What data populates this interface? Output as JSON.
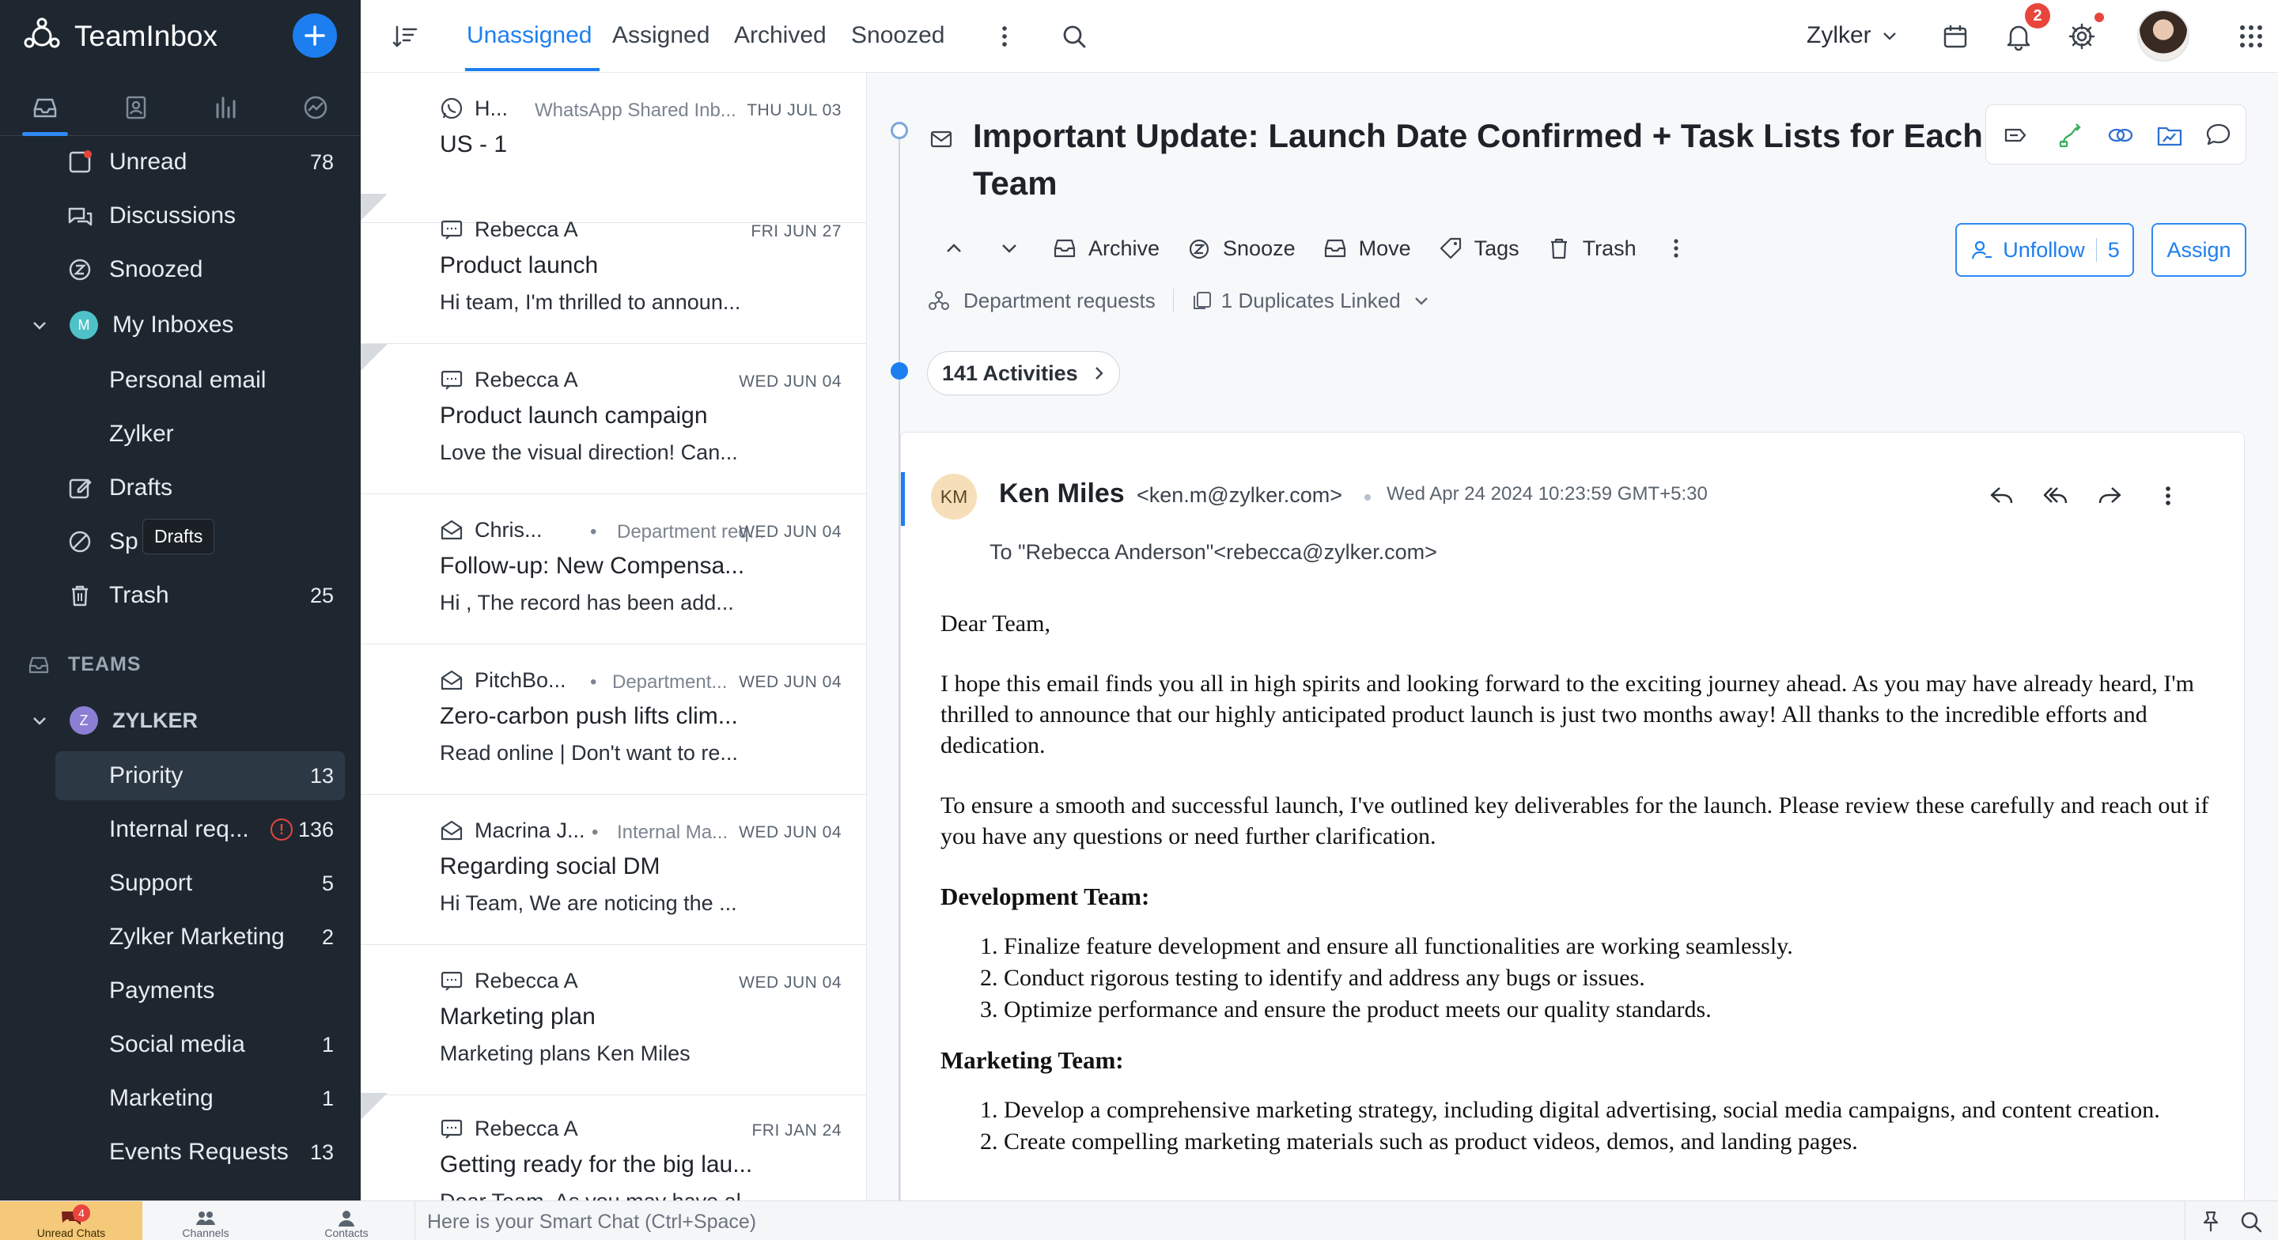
{
  "app": {
    "name": "TeamInbox"
  },
  "sidebar": {
    "tabs": [
      "inbox-tab",
      "contacts-tab",
      "reports-tab",
      "analytics-tab"
    ],
    "items": [
      {
        "label": "Unread",
        "count": "78",
        "icon": "unread-icon"
      },
      {
        "label": "Discussions",
        "count": "",
        "icon": "discussions-icon"
      },
      {
        "label": "Snoozed",
        "count": "",
        "icon": "snooze-icon"
      }
    ],
    "my_inboxes": {
      "label": "My Inboxes",
      "avatar": "M",
      "items": [
        "Personal email",
        "Zylker"
      ]
    },
    "drafts": {
      "label": "Drafts"
    },
    "spam": {
      "label": "Sp"
    },
    "trash": {
      "label": "Trash",
      "count": "25"
    },
    "tooltip": "Drafts",
    "teams": {
      "header": "TEAMS",
      "team_name": "ZYLKER",
      "avatar": "Z"
    },
    "team_items": [
      {
        "label": "Priority",
        "count": "13"
      },
      {
        "label": "Internal req...",
        "count": "136",
        "alert": "!"
      },
      {
        "label": "Support",
        "count": "5"
      },
      {
        "label": "Zylker Marketing",
        "count": "2"
      },
      {
        "label": "Payments",
        "count": ""
      },
      {
        "label": "Social media",
        "count": "1"
      },
      {
        "label": "Marketing",
        "count": "1"
      },
      {
        "label": "Events Requests",
        "count": "13"
      }
    ]
  },
  "topbar": {
    "tabs": [
      "Unassigned",
      "Assigned",
      "Archived",
      "Snoozed"
    ],
    "org": "Zylker",
    "notif_count": "2"
  },
  "tickets": [
    {
      "from": "H...",
      "inbox": "WhatsApp Shared Inb...",
      "date": "THU JUL 03",
      "subject": "US - 1",
      "preview": "",
      "icon": "whatsapp-icon"
    },
    {
      "from": "Rebecca A",
      "inbox": "",
      "date": "FRI JUN 27",
      "subject": "Product launch",
      "preview": "Hi team, I'm thrilled to announ...",
      "icon": "chat-icon"
    },
    {
      "from": "Rebecca A",
      "inbox": "",
      "date": "WED JUN 04",
      "subject": "Product launch campaign",
      "preview": "Love the visual direction! Can...",
      "icon": "chat-icon"
    },
    {
      "from": "Chris...",
      "inbox": "Department req...",
      "date": "WED JUN 04",
      "subject": "Follow-up: New Compensa...",
      "preview": "Hi , The record has been add...",
      "icon": "mail-icon"
    },
    {
      "from": "PitchBo...",
      "inbox": "Department...",
      "date": "WED JUN 04",
      "subject": "Zero-carbon push lifts clim...",
      "preview": "Read online | Don't want to re...",
      "icon": "mail-icon"
    },
    {
      "from": "Macrina J...",
      "inbox": "Internal Ma...",
      "date": "WED JUN 04",
      "subject": "Regarding social DM",
      "preview": "Hi Team, We are noticing the ...",
      "icon": "mail-icon"
    },
    {
      "from": "Rebecca A",
      "inbox": "",
      "date": "WED JUN 04",
      "subject": "Marketing plan",
      "preview": "Marketing plans Ken Miles",
      "icon": "chat-icon"
    },
    {
      "from": "Rebecca A",
      "inbox": "",
      "date": "FRI JAN 24",
      "subject": "Getting ready for the big lau...",
      "preview": "Dear Team, As you may have al...",
      "icon": "chat-icon"
    }
  ],
  "detail": {
    "subject": "Important Update: Launch Date Confirmed + Task Lists for Each Team",
    "toolbar": {
      "archive": "Archive",
      "snooze": "Snooze",
      "move": "Move",
      "tags": "Tags",
      "trash": "Trash"
    },
    "unfollow": "Unfollow",
    "followers": "5",
    "assign": "Assign",
    "department": "Department requests",
    "duplicates": "1 Duplicates Linked",
    "activities": "141 Activities",
    "message": {
      "initials": "KM",
      "sender": "Ken Miles",
      "email": "<ken.m@zylker.com>",
      "date": "Wed Apr 24 2024 10:23:59 GMT+5:30",
      "to": "To  \"Rebecca Anderson\"<rebecca@zylker.com>",
      "greeting": "Dear Team,",
      "para1": "I hope this email finds you all in high spirits and looking forward to the exciting journey ahead. As you may have already heard, I'm thrilled to announce that our highly anticipated product launch is just two months away! All thanks to the incredible efforts and dedication.",
      "para2": "To ensure a smooth and successful launch, I've outlined key deliverables for the launch. Please review these carefully and reach out if you have any questions or need further clarification.",
      "dev_heading": "Development Team:",
      "dev_items": [
        "Finalize feature development and ensure all functionalities are working seamlessly.",
        "Conduct rigorous testing to identify and address any bugs or issues.",
        "Optimize performance and ensure the product meets our quality standards."
      ],
      "mkt_heading": "Marketing Team:",
      "mkt_items": [
        "Develop a comprehensive marketing strategy, including digital advertising, social media campaigns, and content creation.",
        "Create compelling marketing materials such as product videos, demos, and landing pages."
      ]
    }
  },
  "bottom": {
    "unread_chats": "Unread Chats",
    "unread_badge": "4",
    "channels": "Channels",
    "contacts": "Contacts",
    "smart_chat": "Here is your Smart Chat (Ctrl+Space)"
  },
  "colors": {
    "accent": "#1d7ef0",
    "sidebar_bg": "#1e2730",
    "badge": "#e8453c"
  }
}
